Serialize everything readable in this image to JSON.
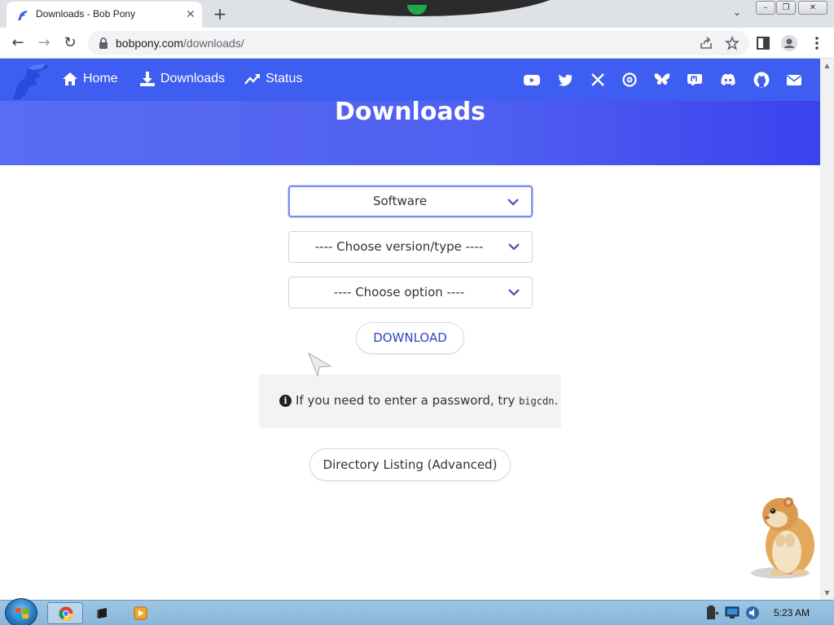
{
  "browser": {
    "tab": {
      "title": "Downloads - Bob Pony",
      "close_glyph": "✕"
    },
    "new_tab_glyph": "+",
    "tab_dropdown_glyph": "⌄",
    "window_controls": {
      "minimize": "–",
      "restore": "❐",
      "close": "✕"
    },
    "nav": {
      "back": "←",
      "forward": "→",
      "reload": "↻"
    },
    "address": {
      "host": "bobpony.com",
      "path": "/downloads/"
    },
    "toolbar_icons": [
      "share-icon",
      "star-icon",
      "side-panel-icon",
      "profile-icon",
      "menu-icon"
    ]
  },
  "site": {
    "nav_links": [
      {
        "label": "Home",
        "icon": "home-icon"
      },
      {
        "label": "Downloads",
        "icon": "download-icon"
      },
      {
        "label": "Status",
        "icon": "trend-icon"
      }
    ],
    "social_icons": [
      "youtube-icon",
      "twitter-icon",
      "x-icon",
      "threads-icon",
      "bluesky-icon",
      "mastodon-icon",
      "discord-icon",
      "github-icon",
      "mail-icon"
    ],
    "hero_title": "Downloads",
    "selects": [
      {
        "value": "Software",
        "focused": true
      },
      {
        "value": "---- Choose version/type ----",
        "focused": false
      },
      {
        "value": "---- Choose option ----",
        "focused": false
      }
    ],
    "download_button": "DOWNLOAD",
    "info": {
      "text": "If you need to enter a password, try",
      "code": "bigcdn",
      "suffix": "."
    },
    "directory_button": "Directory Listing (Advanced)",
    "colors": {
      "navbar": "#3d5ef0",
      "hero": "#4f5ff0",
      "button_text": "#2d45c4"
    }
  },
  "taskbar": {
    "apps": [
      "chrome-icon",
      "terminal-icon",
      "media-player-icon"
    ],
    "clock": "5:23 AM"
  }
}
